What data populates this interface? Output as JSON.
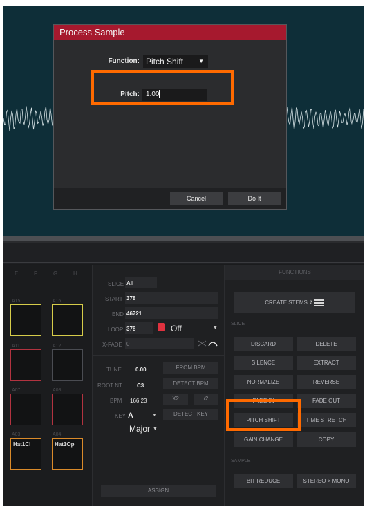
{
  "dialog": {
    "title": "Process Sample",
    "function_label": "Function:",
    "function_value": "Pitch Shift",
    "pitch_label": "Pitch:",
    "pitch_value": "1.00",
    "cancel": "Cancel",
    "do_it": "Do It"
  },
  "colors": {
    "dialog_title": "#a6192e",
    "highlight": "#ff6a00",
    "waveform_bg": "#0e2e38"
  },
  "banks": [
    "E",
    "F",
    "G",
    "H"
  ],
  "pads": [
    {
      "label": "A15",
      "name": "",
      "color": "#d6cc4a"
    },
    {
      "label": "A16",
      "name": "",
      "color": "#d6cc4a"
    },
    {
      "label": "A11",
      "name": "",
      "color": "#b23340"
    },
    {
      "label": "A12",
      "name": "",
      "color": "#4a4c52"
    },
    {
      "label": "A07",
      "name": "",
      "color": "#b23340"
    },
    {
      "label": "A08",
      "name": "",
      "color": "#b23340"
    },
    {
      "label": "A03",
      "name": "Hat1Cl",
      "color": "#d98a2a"
    },
    {
      "label": "A04",
      "name": "Hat1Op",
      "color": "#d98a2a"
    }
  ],
  "sample": {
    "slice_label": "SLICE",
    "slice_value": "All",
    "start_label": "START",
    "start_value": "378",
    "end_label": "END",
    "end_value": "46721",
    "loop_label": "LOOP",
    "loop_value": "378",
    "loop_mode": "Off",
    "xfade_label": "X-FADE",
    "xfade_value": "0"
  },
  "tune": {
    "tune_label": "TUNE",
    "tune_value": "0.00",
    "root_label": "ROOT NT",
    "root_value": "C3",
    "bpm_label": "BPM",
    "bpm_value": "166.23",
    "key_label": "KEY",
    "key_value": "A",
    "scale_value": "Major",
    "from_bpm": "FROM BPM",
    "detect_bpm": "DETECT BPM",
    "x2": "X2",
    "div2": "/2",
    "detect_key": "DETECT KEY",
    "assign": "ASSIGN"
  },
  "functions": {
    "header": "FUNCTIONS",
    "create_stems": "CREATE STEMS",
    "slice_section": "SLICE",
    "discard": "DISCARD",
    "delete": "DELETE",
    "silence": "SILENCE",
    "extract": "EXTRACT",
    "normalize": "NORMALIZE",
    "reverse": "REVERSE",
    "fade_in": "FADE IN",
    "fade_out": "FADE OUT",
    "pitch_shift": "PITCH SHIFT",
    "time_stretch": "TIME STRETCH",
    "gain_change": "GAIN CHANGE",
    "copy": "COPY",
    "sample_section": "SAMPLE",
    "bit_reduce": "BIT REDUCE",
    "stereo_mono": "STEREO > MONO"
  }
}
